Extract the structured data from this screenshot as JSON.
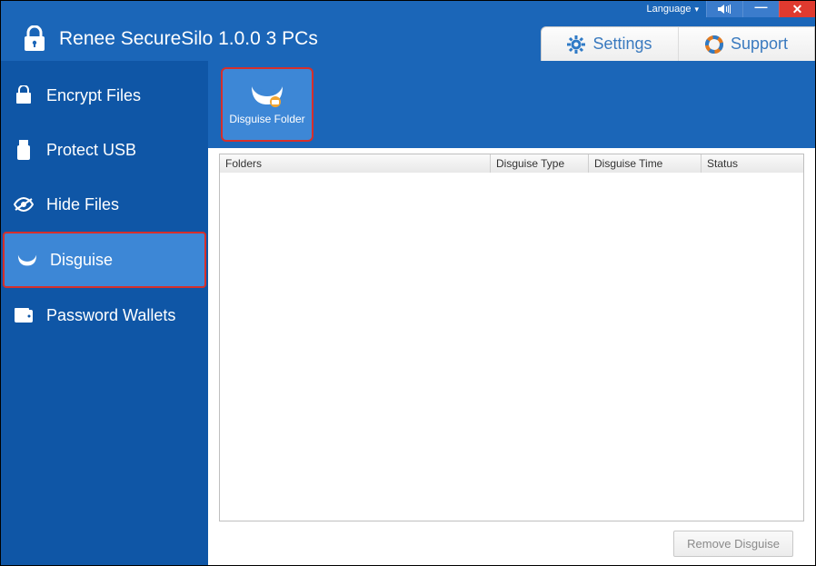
{
  "titlebar": {
    "language_label": "Language",
    "close_glyph": "✕",
    "min_glyph": "—"
  },
  "header": {
    "title": "Renee SecureSilo 1.0.0 3 PCs",
    "tabs": {
      "settings": "Settings",
      "support": "Support"
    }
  },
  "sidebar": {
    "items": [
      {
        "label": "Encrypt Files"
      },
      {
        "label": "Protect USB"
      },
      {
        "label": "Hide Files"
      },
      {
        "label": "Disguise"
      },
      {
        "label": "Password Wallets"
      }
    ],
    "active_index": 3
  },
  "toolbar": {
    "disguise_folder_label": "Disguise Folder"
  },
  "table": {
    "columns": {
      "folders": "Folders",
      "disguise_type": "Disguise Type",
      "disguise_time": "Disguise Time",
      "status": "Status"
    },
    "rows": []
  },
  "footer": {
    "remove_disguise_label": "Remove Disguise"
  }
}
